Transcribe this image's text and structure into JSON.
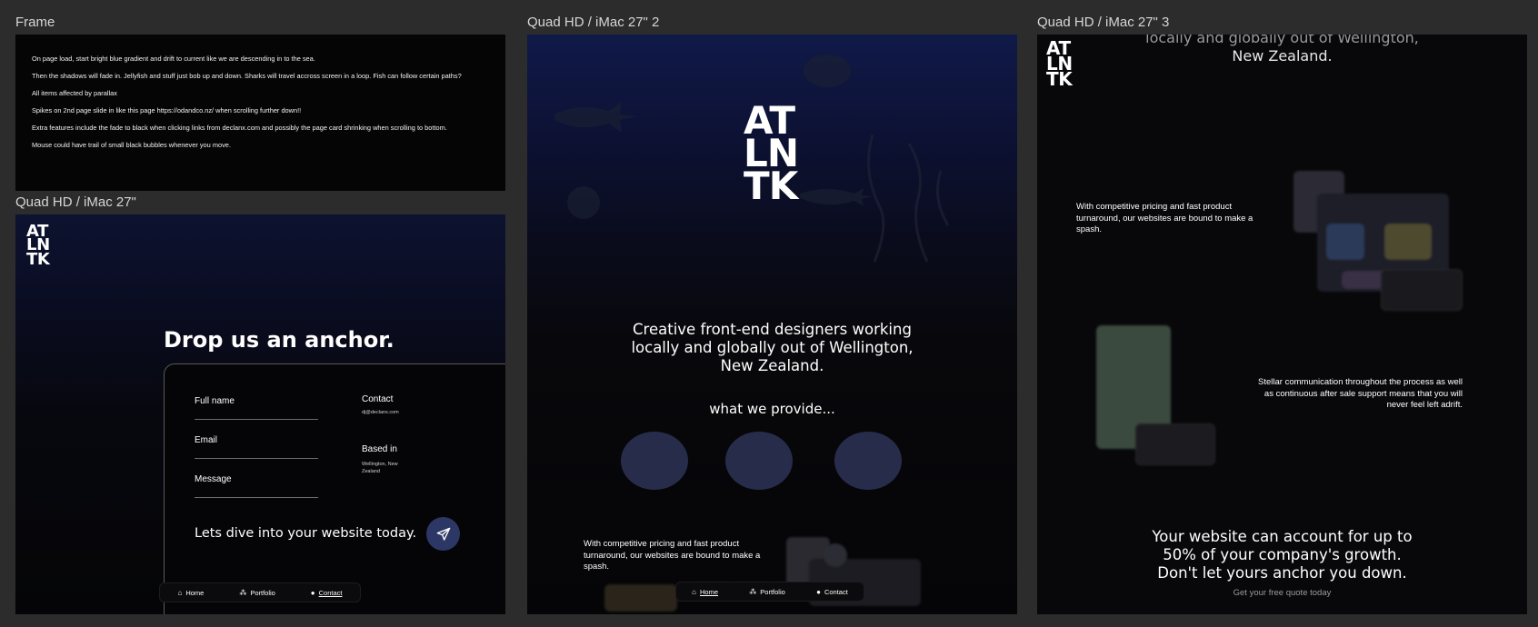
{
  "frames": [
    {
      "label": "Frame"
    },
    {
      "label": "Quad HD / iMac 27\""
    },
    {
      "label": "Quad HD / iMac 27\" 2"
    },
    {
      "label": "Quad HD / iMac 27\" 3"
    }
  ],
  "notes": [
    "On page load, start bright blue gradient and drift to current like we are descending in to the sea.",
    "Then the shadows will fade in.  Jellyfish and stuff just bob up and down. Sharks will travel accross screen in a loop. Fish can follow certain paths?",
    "All items affected by parallax",
    "Spikes on 2nd page slide in like this page https://odandco.nz/ when scrolling further down!!",
    "Extra features include the fade to black when clicking links from declanx.com and possibly the page card shrinking when scrolling to bottom.",
    "Mouse could have trail of small black bubbles whenever you move."
  ],
  "logo": {
    "line1": "AT",
    "line2": "LN",
    "line3": "TK"
  },
  "contact_page": {
    "heading": "Drop us an anchor.",
    "fields": {
      "name": "Full name",
      "email": "Email",
      "message": "Message"
    },
    "contact_title": "Contact",
    "contact_email": "dj@declanx.com",
    "based_title": "Based in",
    "based_value": "Wellington, New Zealand",
    "cta": "Lets dive into your website today."
  },
  "nav": {
    "home": "Home",
    "portfolio": "Portfolio",
    "contact": "Contact"
  },
  "home_page": {
    "tagline": [
      "Creative front-end designers working",
      "locally and globally out of Wellington,",
      "New Zealand."
    ],
    "provide": "what we provide...",
    "blurb": "With competitive pricing and fast product turnaround, our websites are bound to make a spash."
  },
  "scroll_page": {
    "top_text": [
      "locally and globally out of Wellington,",
      "New Zealand."
    ],
    "blurb1": "With competitive pricing and fast product turnaround, our websites are bound to make a spash.",
    "blurb2": "Stellar communication throughout the process as well as continuous after sale support means that you will never feel left adrift.",
    "growth": [
      "Your website can account for up to",
      "50% of your company's growth.",
      "Don't let yours anchor you down."
    ],
    "quote": "Get your free quote today"
  },
  "colors": {
    "canvas": "#2c2c2c",
    "frame_bg": "#050507",
    "deep_blue": "#101a48",
    "accent_button": "#2d3766",
    "oval": "#272c4b"
  },
  "icons": [
    "home-icon",
    "portfolio-icon",
    "contact-icon",
    "send-icon"
  ]
}
